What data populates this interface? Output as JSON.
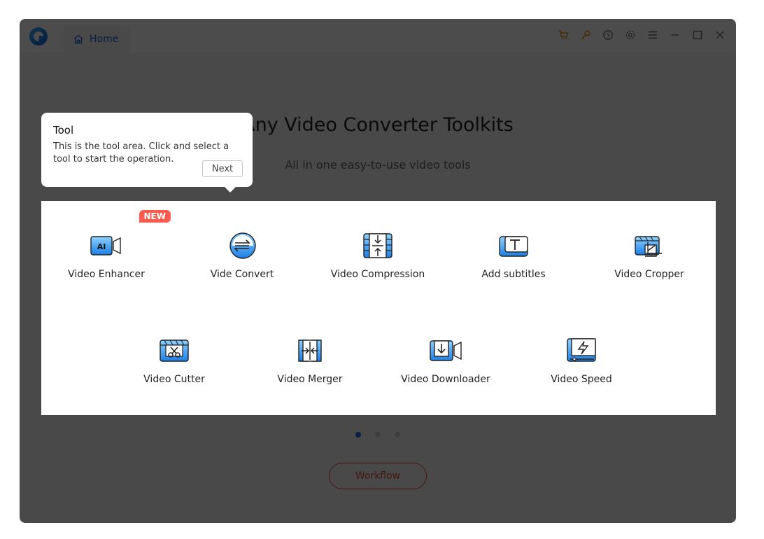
{
  "titlebar": {
    "home_tab_label": "Home",
    "icons": [
      "cart-icon",
      "key-icon",
      "history-icon",
      "settings-icon",
      "menu-icon",
      "minimize-icon",
      "maximize-icon",
      "close-icon"
    ]
  },
  "main": {
    "title": "Any Video Converter Toolkits",
    "subtitle": "All in one easy-to-use video tools",
    "tools": [
      {
        "label": "Video Enhancer",
        "badge": "NEW",
        "icon": "ai-enhance-icon"
      },
      {
        "label": "Vide Convert",
        "icon": "convert-icon"
      },
      {
        "label": "Video Compression",
        "icon": "compression-icon"
      },
      {
        "label": "Add subtitles",
        "icon": "subtitles-icon"
      },
      {
        "label": "Video Cropper",
        "icon": "crop-icon"
      },
      {
        "label": "Video Cutter",
        "icon": "scissors-icon"
      },
      {
        "label": "Video Merger",
        "icon": "merge-icon"
      },
      {
        "label": "Video Downloader",
        "icon": "download-icon"
      },
      {
        "label": "Video Speed",
        "icon": "speed-icon"
      }
    ],
    "pagination": {
      "pages": 3,
      "current": 1
    },
    "workflow_label": "Workflow"
  },
  "tooltip": {
    "title": "Tool",
    "body": "This is the tool area. Click and select a tool to start the operation.",
    "next_label": "Next"
  },
  "colors": {
    "accent": "#1c66e6",
    "new_badge": "#ff5a4e",
    "workflow": "#e84b3b"
  }
}
